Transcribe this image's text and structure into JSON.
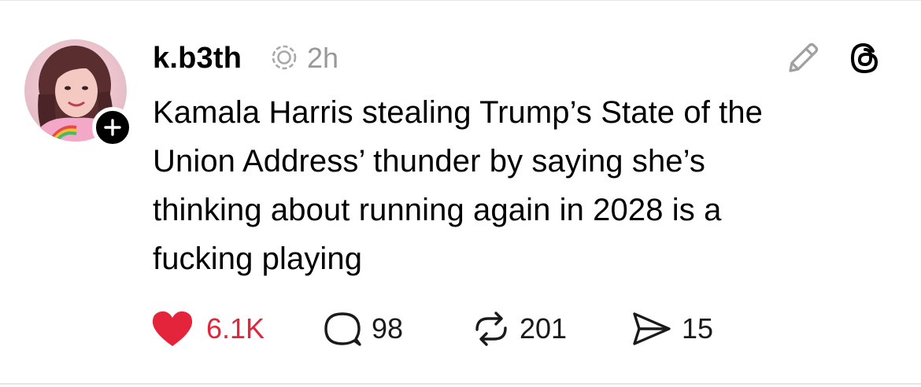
{
  "post": {
    "username": "k.b3th",
    "timestamp": "2h",
    "text_lines": [
      "Kamala Harris stealing Trump’s State of the",
      "Union Address’ thunder by saying she’s",
      "thinking about running again in 2028 is a",
      "fucking playing"
    ]
  },
  "actions": {
    "likes": "6.1K",
    "comments": "98",
    "reposts": "201",
    "shares": "15"
  },
  "icons": {
    "verified": "verified-badge-icon",
    "edit": "pencil-icon",
    "threads": "threads-logo-icon",
    "like": "heart-icon",
    "comment": "comment-bubble-icon",
    "repost": "repost-icon",
    "share": "send-icon",
    "follow": "plus-icon"
  },
  "colors": {
    "like_active": "#e3243b",
    "muted": "#999999",
    "text": "#000000"
  }
}
